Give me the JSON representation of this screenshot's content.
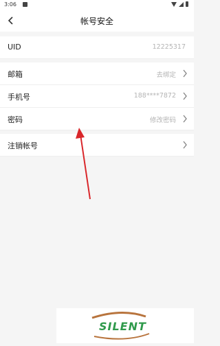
{
  "status": {
    "time": "3:06"
  },
  "header": {
    "title": "帐号安全"
  },
  "rows": {
    "uid": {
      "label": "UID",
      "value": "12225317"
    },
    "email": {
      "label": "邮箱",
      "value": "去绑定"
    },
    "phone": {
      "label": "手机号",
      "value": "188****7872"
    },
    "password": {
      "label": "密码",
      "value": "修改密码"
    },
    "delete": {
      "label": "注销帐号"
    }
  },
  "watermark": {
    "text": "SILENT"
  },
  "colors": {
    "accent_red": "#d9262a",
    "watermark_green": "#2f9a4b",
    "watermark_brown": "#b8743d"
  }
}
